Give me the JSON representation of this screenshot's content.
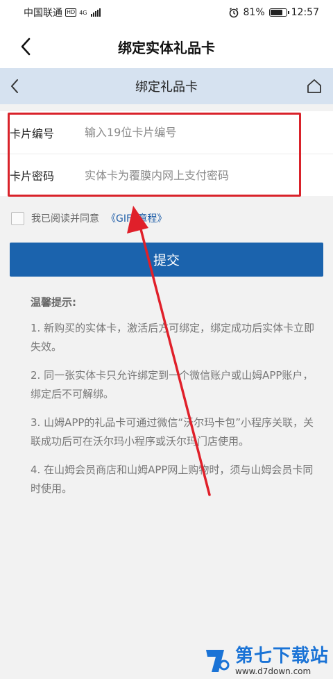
{
  "status_bar": {
    "carrier": "中国联通",
    "hd": "HD",
    "network": "4G",
    "battery_percent": "81%",
    "time": "12:57"
  },
  "app_header": {
    "title": "绑定实体礼品卡"
  },
  "web_header": {
    "title": "绑定礼品卡"
  },
  "form": {
    "card_number_label": "卡片编号",
    "card_number_placeholder": "输入19位卡片编号",
    "card_password_label": "卡片密码",
    "card_password_placeholder": "实体卡为覆膜内网上支付密码"
  },
  "agreement": {
    "text": "我已阅读并同意",
    "link": "《GIFT章程》"
  },
  "submit_label": "提交",
  "tips": {
    "title": "温馨提示:",
    "items": [
      "1. 新购买的实体卡，激活后方可绑定，绑定成功后实体卡立即失效。",
      "2. 同一张实体卡只允许绑定到一个微信账户或山姆APP账户，绑定后不可解绑。",
      "3. 山姆APP的礼品卡可通过微信“沃尔玛卡包”小程序关联，关联成功后可在沃尔玛小程序或沃尔玛门店使用。",
      "4. 在山姆会员商店和山姆APP网上购物时，须与山姆会员卡同时使用。"
    ]
  },
  "watermark": {
    "name": "第七下载站",
    "url": "www.d7down.com"
  },
  "colors": {
    "accent": "#1b63ad",
    "highlight": "#d9222a",
    "web_header_bg": "#d6e2f0"
  },
  "battery_level": 0.81
}
